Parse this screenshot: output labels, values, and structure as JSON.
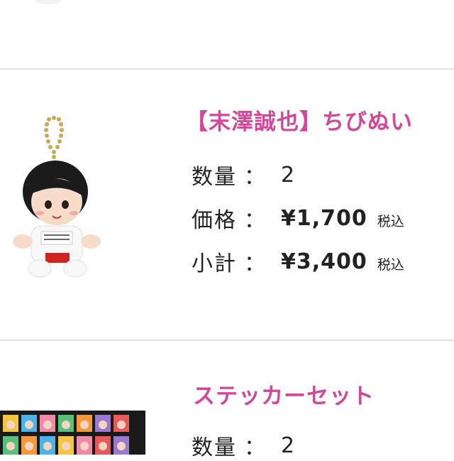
{
  "theme": {
    "accent": "#d2479a",
    "divider": "#e3e3e3"
  },
  "items": [
    {
      "title": "【末澤誠也】ちびぬい",
      "quantity_label": "数量",
      "quantity": "2",
      "price_label": "価格",
      "price": "¥1,700",
      "price_tax": "税込",
      "subtotal_label": "小計",
      "subtotal": "¥3,400",
      "subtotal_tax": "税込",
      "image_icon": "plush-keychain-image"
    },
    {
      "title": "ステッカーセット",
      "quantity_label": "数量",
      "quantity": "2",
      "image_icon": "sticker-sheet-image"
    }
  ],
  "colon": "："
}
